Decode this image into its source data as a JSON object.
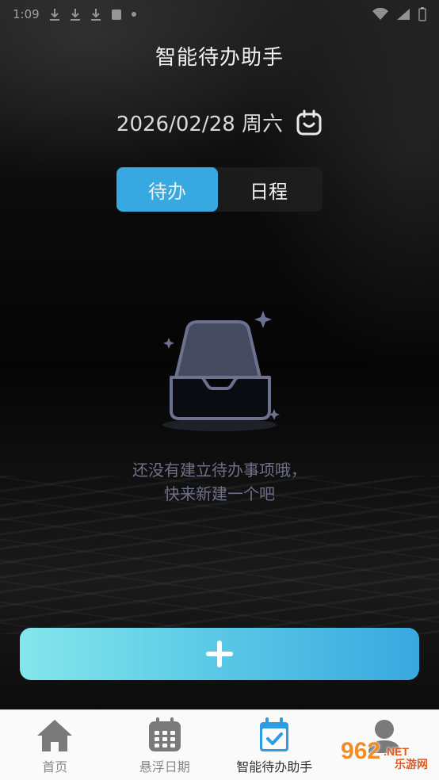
{
  "status_bar": {
    "time": "1:09",
    "icons": [
      "download-icon",
      "download-icon",
      "notification-icon",
      "dot-icon",
      "wifi-icon",
      "signal-icon",
      "battery-icon"
    ]
  },
  "header": {
    "title": "智能待办助手",
    "date": "2026/02/28",
    "weekday": "周六"
  },
  "tabs": [
    {
      "label": "待办",
      "active": true
    },
    {
      "label": "日程",
      "active": false
    }
  ],
  "empty_state": {
    "line1": "还没有建立待办事项哦，",
    "line2": "快来新建一个吧"
  },
  "add_button": {
    "icon": "plus-icon"
  },
  "bottom_nav": {
    "items": [
      {
        "label": "首页",
        "icon": "home-icon",
        "active": false
      },
      {
        "label": "悬浮日期",
        "icon": "calendar-grid-icon",
        "active": false
      },
      {
        "label": "智能待办助手",
        "icon": "calendar-check-icon",
        "active": true
      },
      {
        "label": "",
        "icon": "user-icon",
        "active": false
      }
    ]
  },
  "watermark": {
    "brand": "962",
    "suffix": ".NET",
    "subtitle": "乐游网"
  },
  "colors": {
    "accent": "#37a8e0",
    "button_gradient_start": "#85e6ec",
    "button_gradient_end": "#3aa8e0",
    "empty_text": "#6e7288",
    "nav_icon_blue": "#2f9be0",
    "nav_icon_gray": "#7a7a7a"
  }
}
